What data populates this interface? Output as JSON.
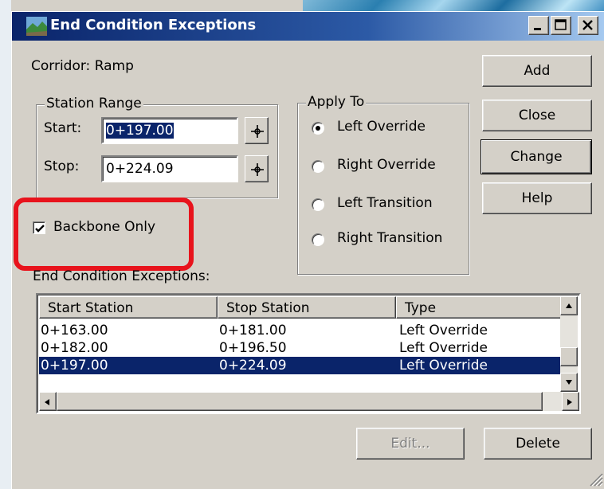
{
  "window": {
    "title": "End Condition Exceptions",
    "controls": {
      "minimize": "minimize-icon",
      "maximize": "maximize-icon",
      "close": "close-icon"
    }
  },
  "corridor": {
    "label": "Corridor:",
    "value": "Ramp"
  },
  "station_range": {
    "title": "Station Range",
    "start_label": "Start:",
    "start_value": "0+197.00",
    "stop_label": "Stop:",
    "stop_value": "0+224.09"
  },
  "apply_to": {
    "title": "Apply To",
    "options": [
      "Left Override",
      "Right Override",
      "Left Transition",
      "Right Transition"
    ],
    "selected": "Left Override"
  },
  "backbone_only": {
    "label": "Backbone Only",
    "checked": true
  },
  "buttons": {
    "add": "Add",
    "close": "Close",
    "change": "Change",
    "help": "Help",
    "edit": "Edit...",
    "delete": "Delete"
  },
  "exceptions": {
    "label": "End Condition Exceptions:",
    "columns": [
      "Start Station",
      "Stop Station",
      "Type"
    ],
    "rows": [
      [
        "0+163.00",
        "0+181.00",
        "Left Override"
      ],
      [
        "0+182.00",
        "0+196.50",
        "Left Override"
      ],
      [
        "0+197.00",
        "0+224.09",
        "Left Override"
      ]
    ],
    "selected_row": 2
  },
  "colors": {
    "highlight": "#e8131c",
    "selection": "#0a246a",
    "title_gradient_start": "#0a246a"
  }
}
